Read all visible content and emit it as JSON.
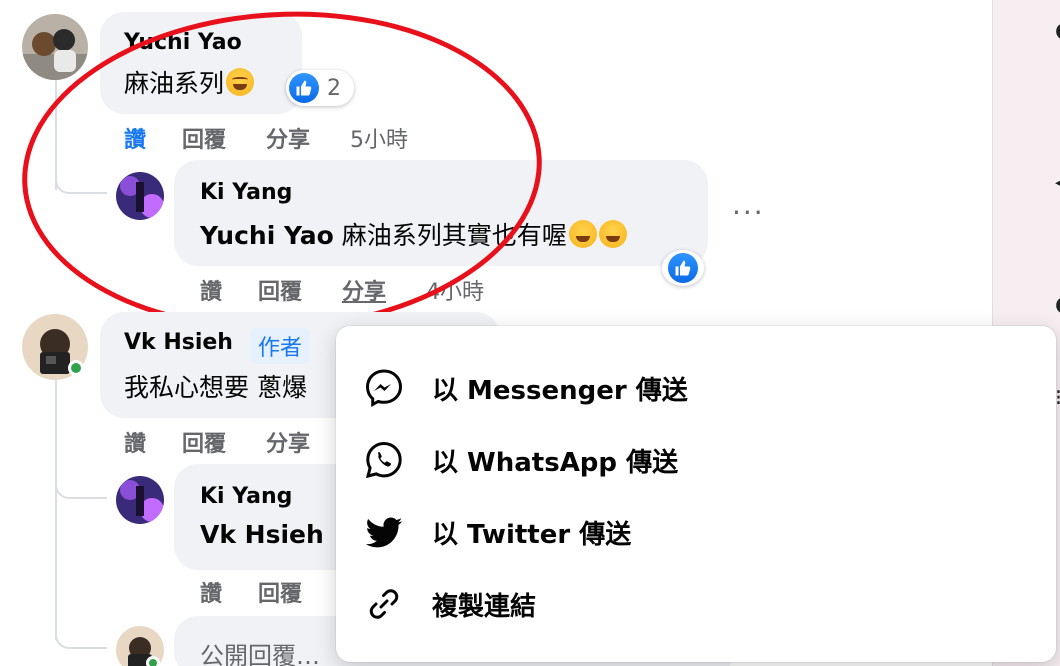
{
  "comments": [
    {
      "author": "Yuchi Yao",
      "text": "麻油系列",
      "reaction_count": "2",
      "actions": {
        "like": "讚",
        "reply": "回覆",
        "share": "分享"
      },
      "time": "5小時"
    }
  ],
  "replies": [
    {
      "author": "Ki Yang",
      "mention": "Yuchi Yao",
      "text": "麻油系列其實也有喔",
      "actions": {
        "like": "讚",
        "reply": "回覆",
        "share": "分享"
      },
      "time": "4小時",
      "more": "···"
    }
  ],
  "comment2": {
    "author": "Vk Hsieh",
    "author_tag": "作者",
    "text": "我私心想要 蔥爆",
    "actions": {
      "like": "讚",
      "reply": "回覆",
      "share": "分享"
    }
  },
  "reply2": {
    "author": "Ki Yang",
    "mention": "Vk Hsieh",
    "actions": {
      "like": "讚",
      "reply": "回覆"
    }
  },
  "reply_box": {
    "placeholder": "公開回覆…"
  },
  "share_menu": {
    "items": [
      {
        "label": "以 Messenger 傳送",
        "icon": "messenger-icon"
      },
      {
        "label": "以 WhatsApp 傳送",
        "icon": "whatsapp-icon"
      },
      {
        "label": "以 Twitter 傳送",
        "icon": "twitter-icon"
      },
      {
        "label": "複製連結",
        "icon": "link-icon"
      }
    ]
  },
  "colors": {
    "accent": "#1877f2",
    "annotation": "#e8101a",
    "bubble": "#f0f2f5"
  }
}
